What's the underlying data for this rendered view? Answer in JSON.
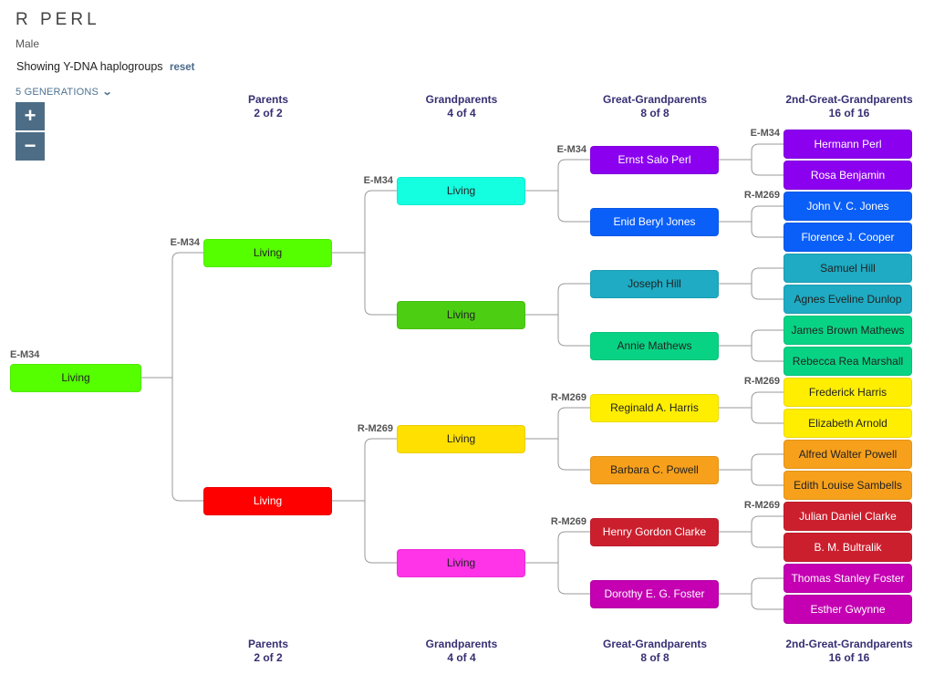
{
  "header": {
    "title": "R PERL",
    "sex": "Male",
    "showing": "Showing Y-DNA haplogroups",
    "reset_label": "reset",
    "generations_label": "5 GENERATIONS",
    "chevron_icon": "chevron-down-icon",
    "zoom_in_label": "+",
    "zoom_out_label": "−"
  },
  "columns": [
    {
      "title": "Parents",
      "count": "2 of 2"
    },
    {
      "title": "Grandparents",
      "count": "4 of 4"
    },
    {
      "title": "Great-Grandparents",
      "count": "8 of 8"
    },
    {
      "title": "2nd-Great-Grandparents",
      "count": "16 of 16"
    }
  ],
  "tree": {
    "root": {
      "name": "Living",
      "haplogroup": "E-M34",
      "color": "#55ff00",
      "text": "#222222"
    },
    "generations": [
      [
        {
          "name": "Living",
          "haplogroup": "E-M34",
          "color": "#55ff00",
          "text": "#222222"
        },
        {
          "name": "Living",
          "haplogroup": "",
          "color": "#ff0000",
          "text": "#ffffff"
        }
      ],
      [
        {
          "name": "Living",
          "haplogroup": "E-M34",
          "color": "#14ffe0",
          "text": "#222222"
        },
        {
          "name": "Living",
          "haplogroup": "",
          "color": "#4ccf12",
          "text": "#222222"
        },
        {
          "name": "Living",
          "haplogroup": "R-M269",
          "color": "#ffe000",
          "text": "#222222"
        },
        {
          "name": "Living",
          "haplogroup": "",
          "color": "#ff33e8",
          "text": "#222222"
        }
      ],
      [
        {
          "name": "Ernst Salo Perl",
          "haplogroup": "E-M34",
          "color": "#8b00ee",
          "text": "#ffffff"
        },
        {
          "name": "Enid Beryl Jones",
          "haplogroup": "",
          "color": "#0a5ff8",
          "text": "#ffffff"
        },
        {
          "name": "Joseph Hill",
          "haplogroup": "",
          "color": "#1eabc3",
          "text": "#222222"
        },
        {
          "name": "Annie Mathews",
          "haplogroup": "",
          "color": "#08d384",
          "text": "#222222"
        },
        {
          "name": "Reginald A. Harris",
          "haplogroup": "R-M269",
          "color": "#ffee00",
          "text": "#222222"
        },
        {
          "name": "Barbara C. Powell",
          "haplogroup": "",
          "color": "#f7a01c",
          "text": "#222222"
        },
        {
          "name": "Henry Gordon Clarke",
          "haplogroup": "R-M269",
          "color": "#cc1f2e",
          "text": "#ffffff"
        },
        {
          "name": "Dorothy E. G. Foster",
          "haplogroup": "",
          "color": "#c400b2",
          "text": "#ffffff"
        }
      ],
      [
        {
          "name": "Hermann Perl",
          "haplogroup": "E-M34",
          "color": "#8b00ee",
          "text": "#ffffff"
        },
        {
          "name": "Rosa Benjamin",
          "haplogroup": "",
          "color": "#8b00ee",
          "text": "#ffffff"
        },
        {
          "name": "John V. C. Jones",
          "haplogroup": "R-M269",
          "color": "#0a5ff8",
          "text": "#ffffff"
        },
        {
          "name": "Florence J. Cooper",
          "haplogroup": "",
          "color": "#0a5ff8",
          "text": "#ffffff"
        },
        {
          "name": "Samuel Hill",
          "haplogroup": "",
          "color": "#1eabc3",
          "text": "#222222"
        },
        {
          "name": "Agnes Eveline Dunlop",
          "haplogroup": "",
          "color": "#1eabc3",
          "text": "#222222"
        },
        {
          "name": "James Brown Mathews",
          "haplogroup": "",
          "color": "#08d384",
          "text": "#222222"
        },
        {
          "name": "Rebecca Rea Marshall",
          "haplogroup": "",
          "color": "#08d384",
          "text": "#222222"
        },
        {
          "name": "Frederick Harris",
          "haplogroup": "R-M269",
          "color": "#ffee00",
          "text": "#222222"
        },
        {
          "name": "Elizabeth Arnold",
          "haplogroup": "",
          "color": "#ffee00",
          "text": "#222222"
        },
        {
          "name": "Alfred Walter Powell",
          "haplogroup": "",
          "color": "#f7a01c",
          "text": "#222222"
        },
        {
          "name": "Edith Louise Sambells",
          "haplogroup": "",
          "color": "#f7a01c",
          "text": "#222222"
        },
        {
          "name": "Julian Daniel Clarke",
          "haplogroup": "R-M269",
          "color": "#cc1f2e",
          "text": "#ffffff"
        },
        {
          "name": "B. M. Bultralik",
          "haplogroup": "",
          "color": "#cc1f2e",
          "text": "#ffffff"
        },
        {
          "name": "Thomas Stanley Foster",
          "haplogroup": "",
          "color": "#c400b2",
          "text": "#ffffff"
        },
        {
          "name": "Esther Gwynne",
          "haplogroup": "",
          "color": "#c400b2",
          "text": "#ffffff"
        }
      ]
    ]
  }
}
